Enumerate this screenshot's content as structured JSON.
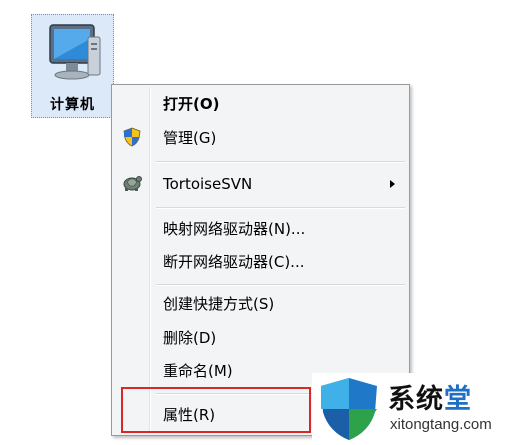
{
  "desktop_icon": {
    "label": "计算机",
    "icon": "computer-icon"
  },
  "context_menu": {
    "items": [
      {
        "label": "打开(O)",
        "bold": true
      },
      {
        "label": "管理(G)",
        "icon": "uac-shield-icon"
      },
      {
        "label": "TortoiseSVN",
        "icon": "tortoisesvn-icon",
        "submenu": true
      },
      {
        "label": "映射网络驱动器(N)..."
      },
      {
        "label": "断开网络驱动器(C)..."
      },
      {
        "label": "创建快捷方式(S)"
      },
      {
        "label": "删除(D)"
      },
      {
        "label": "重命名(M)"
      },
      {
        "label": "属性(R)"
      }
    ],
    "highlight_color": "#d7292b"
  },
  "watermark": {
    "brand_part1": "系统",
    "brand_part2": "堂",
    "domain": "xitongtang.com"
  }
}
